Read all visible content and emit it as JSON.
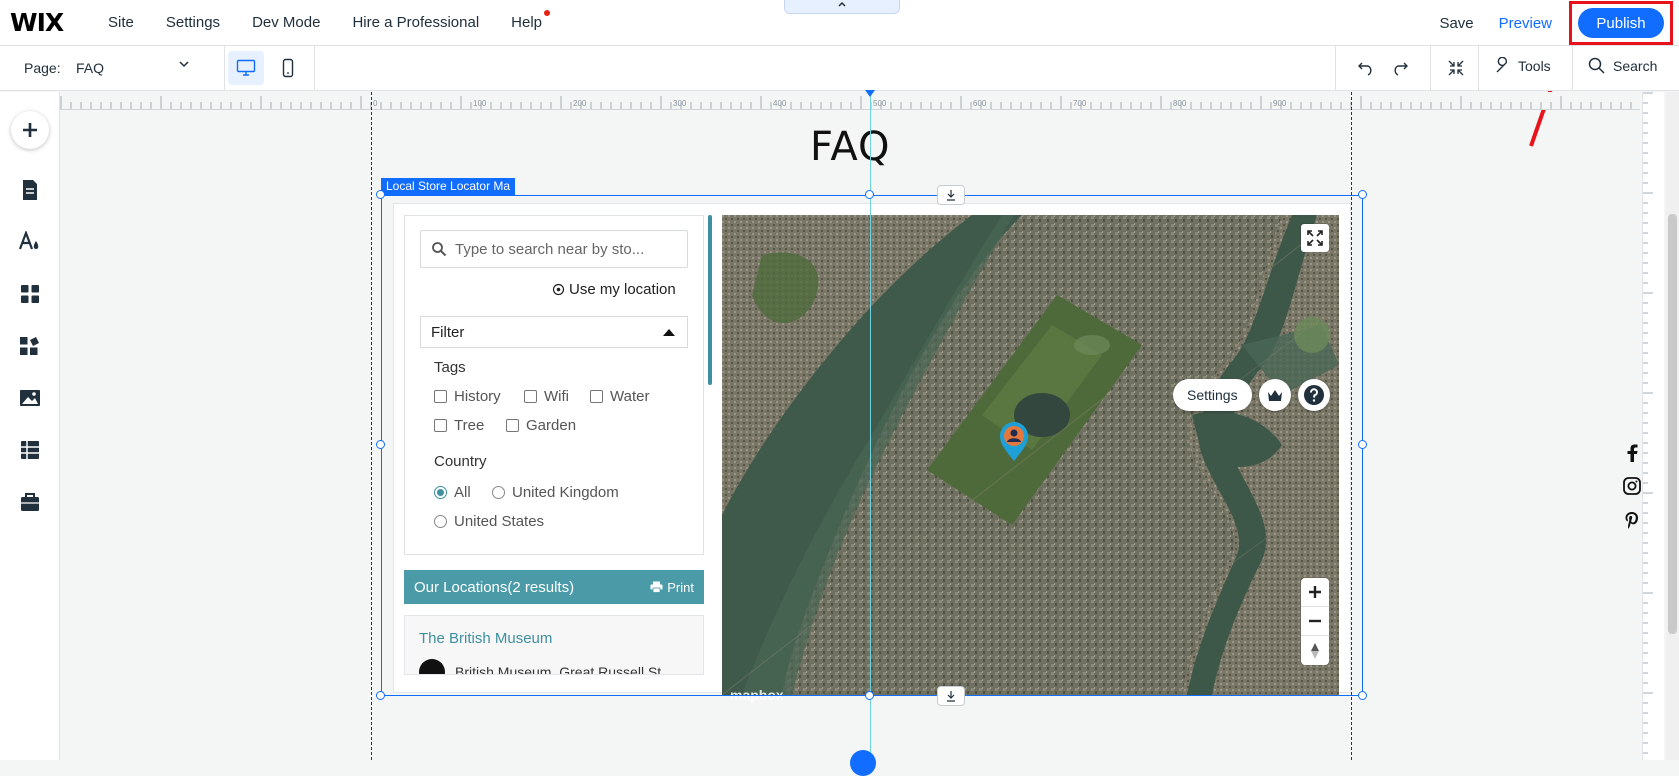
{
  "topbar": {
    "logo": "WIX",
    "nav": [
      "Site",
      "Settings",
      "Dev Mode",
      "Hire a Professional",
      "Help"
    ],
    "save": "Save",
    "preview": "Preview",
    "publish": "Publish"
  },
  "secondbar": {
    "page_label": "Page:",
    "page_value": "FAQ",
    "tools": "Tools",
    "search": "Search"
  },
  "ruler": {
    "ticks": [
      "0",
      "100",
      "200",
      "300",
      "400",
      "500",
      "600",
      "700",
      "800",
      "900"
    ]
  },
  "page": {
    "title": "FAQ"
  },
  "widget": {
    "tag": "Local Store Locator Ma",
    "search_placeholder": "Type to search near by sto...",
    "use_location": "Use my location",
    "filter_label": "Filter",
    "tags_title": "Tags",
    "tags": [
      "History",
      "Wifi",
      "Water",
      "Tree",
      "Garden"
    ],
    "country_title": "Country",
    "countries": [
      "All",
      "United Kingdom",
      "United States"
    ],
    "country_selected": "All",
    "locations_header": "Our Locations(2 results)",
    "print_label": "Print",
    "first_location_name": "The British Museum",
    "first_location_address": "British Museum, Great Russell St"
  },
  "map": {
    "settings": "Settings",
    "attribution": "mapbox"
  },
  "icons": {
    "add": "plus-icon",
    "pages": "pages-icon",
    "design": "design-icon",
    "apps": "apps-icon",
    "business": "business-icon",
    "media": "media-icon",
    "cms": "cms-icon",
    "portfolio": "briefcase-icon"
  },
  "colors": {
    "accent": "#116dff",
    "publish_highlight": "#e8131a",
    "teal": "#4a9aa8"
  }
}
